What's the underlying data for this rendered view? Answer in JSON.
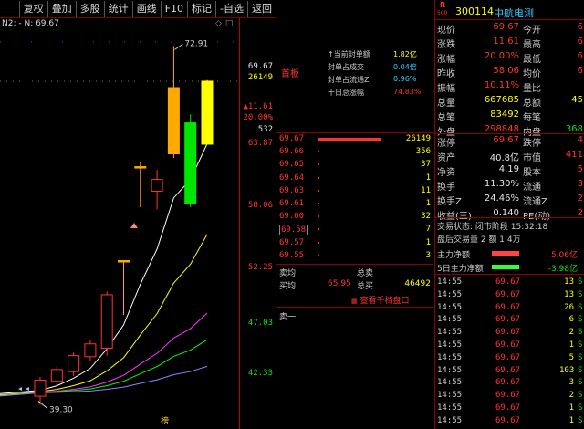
{
  "toolbar": {
    "items": [
      "复权",
      "叠加",
      "多股",
      "统计",
      "画线",
      "F10",
      "标记",
      "-自选",
      "返回"
    ]
  },
  "indicator": {
    "label": "N2: - N: 69.67",
    "icons": [
      "diamond-icon",
      "square-icon"
    ]
  },
  "chart": {
    "high_label": "72.91",
    "low_label": "39.30",
    "bottom_marker": "榜",
    "candles": [
      {
        "o": 40.1,
        "c": 41.6,
        "h": 41.9,
        "l": 39.3,
        "color": "red"
      },
      {
        "o": 41.5,
        "c": 42.6,
        "h": 42.9,
        "l": 41.1,
        "color": "red"
      },
      {
        "o": 42.4,
        "c": 43.9,
        "h": 44.2,
        "l": 42.0,
        "color": "red"
      },
      {
        "o": 43.8,
        "c": 45.0,
        "h": 45.4,
        "l": 43.4,
        "color": "red"
      },
      {
        "o": 44.6,
        "c": 49.6,
        "h": 49.9,
        "l": 43.9,
        "color": "red"
      },
      {
        "o": 52.8,
        "c": 52.8,
        "h": 52.8,
        "l": 47.7,
        "color": "orange"
      },
      {
        "o": 61.6,
        "c": 61.6,
        "h": 62.0,
        "l": 57.8,
        "color": "orange"
      },
      {
        "o": 59.3,
        "c": 60.4,
        "h": 61.3,
        "l": 57.6,
        "color": "red"
      },
      {
        "o": 62.8,
        "c": 69.0,
        "h": 72.9,
        "l": 62.4,
        "color": "orange"
      },
      {
        "o": 65.7,
        "c": 58.1,
        "h": 66.5,
        "l": 57.8,
        "color": "green"
      },
      {
        "o": 63.7,
        "c": 69.6,
        "h": 69.7,
        "l": 63.7,
        "color": "yellow"
      }
    ]
  },
  "price_axis": {
    "top_values": [
      "69.67",
      "26149",
      "▲11.61",
      "20.00%",
      "532"
    ],
    "ticks": [
      "63.87",
      "58.06",
      "52.25",
      "47.03",
      "42.33"
    ]
  },
  "seal": {
    "badge": "首板",
    "rows": [
      {
        "label": "↑当前封单额",
        "value": "1.82亿"
      },
      {
        "label": "封单占成交",
        "value": "0.04倍"
      },
      {
        "label": "封单占流通Z",
        "value": "0.96%"
      },
      {
        "label": "十日总涨幅",
        "value": "74.83%"
      }
    ]
  },
  "bids": [
    {
      "price": "69.67",
      "vol": "26149"
    },
    {
      "price": "69.66",
      "vol": "356"
    },
    {
      "price": "69.65",
      "vol": "37"
    },
    {
      "price": "69.64",
      "vol": "1"
    },
    {
      "price": "69.63",
      "vol": "11"
    },
    {
      "price": "69.61",
      "vol": "1"
    },
    {
      "price": "69.60",
      "vol": "32"
    },
    {
      "price": "69.58",
      "vol": "7"
    },
    {
      "price": "69.57",
      "vol": "1"
    },
    {
      "price": "69.55",
      "vol": "3"
    }
  ],
  "trade_summary": {
    "sell_label": "卖均",
    "total_sell_label": "总卖",
    "buy_label": "买均",
    "buy_avg": "65.95",
    "total_buy_label": "总买",
    "total_buy": "46492",
    "link": "查看千档盘口"
  },
  "ask_label": "卖一",
  "stock": {
    "badge_top": "R",
    "badge_bottom": "500",
    "code": "300114",
    "name": "中航电测"
  },
  "quote": [
    {
      "k1": "现价",
      "v1": "69.67",
      "k2": "今开",
      "v2": "6"
    },
    {
      "k1": "涨跌",
      "v1": "11.61",
      "k2": "最高",
      "v2": "6"
    },
    {
      "k1": "涨幅",
      "v1": "20.00%",
      "k2": "最低",
      "v2": "6"
    },
    {
      "k1": "昨收",
      "v1": "58.06",
      "k2": "均价",
      "v2": "6"
    },
    {
      "k1": "振幅",
      "v1": "10.11%",
      "k2": "量比",
      "v2": ""
    },
    {
      "k1": "总量",
      "v1": "667685",
      "k2": "总额",
      "v2": "45"
    },
    {
      "k1": "总笔",
      "v1": "83492",
      "k2": "每笔",
      "v2": ""
    },
    {
      "k1": "外盘",
      "v1": "298848",
      "k2": "内盘",
      "v2": "368"
    }
  ],
  "fundamentals": [
    {
      "k1": "涨停",
      "v1": "69.67",
      "k2": "跌停",
      "v2": "4"
    },
    {
      "k1": "资产",
      "v1": "40.8亿",
      "k2": "市值",
      "v2": "411"
    },
    {
      "k1": "净资",
      "v1": "4.19",
      "k2": "股本",
      "v2": "5"
    },
    {
      "k1": "换手",
      "v1": "11.30%",
      "k2": "流通",
      "v2": "3"
    },
    {
      "k1": "换手Z",
      "v1": "24.46%",
      "k2": "流通Z",
      "v2": "2"
    },
    {
      "k1": "收益(三)",
      "v1": "0.140",
      "k2": "PE(动)",
      "v2": "2"
    }
  ],
  "status": {
    "trade_state": "交易状态: 闭市阶段 15:32:18",
    "after_hours": "盘后交易量 2 额 1.4万"
  },
  "flows": [
    {
      "label": "主力净额",
      "value": "5.06亿",
      "color": "#ff4444"
    },
    {
      "label": "5日主力净额",
      "value": "-3.98亿",
      "color": "#33ff33"
    }
  ],
  "ticks": [
    {
      "time": "14:55",
      "price": "69.67",
      "vol": "13",
      "side": "S"
    },
    {
      "time": "14:55",
      "price": "69.67",
      "vol": "13",
      "side": "S"
    },
    {
      "time": "14:55",
      "price": "69.67",
      "vol": "26",
      "side": "S"
    },
    {
      "time": "14:55",
      "price": "69.67",
      "vol": "6",
      "side": "S"
    },
    {
      "time": "14:55",
      "price": "69.67",
      "vol": "2",
      "side": "S"
    },
    {
      "time": "14:55",
      "price": "69.67",
      "vol": "1",
      "side": "S"
    },
    {
      "time": "14:55",
      "price": "69.67",
      "vol": "5",
      "side": "S"
    },
    {
      "time": "14:55",
      "price": "69.67",
      "vol": "103",
      "side": "S"
    },
    {
      "time": "14:55",
      "price": "69.67",
      "vol": "3",
      "side": "S"
    },
    {
      "time": "14:55",
      "price": "69.67",
      "vol": "2",
      "side": "S"
    },
    {
      "time": "14:55",
      "price": "69.67",
      "vol": "1",
      "side": "S"
    },
    {
      "time": "14:55",
      "price": "69.67",
      "vol": "1",
      "side": "S"
    }
  ],
  "colors": {
    "up": "#ff3232",
    "down": "#00e600",
    "orange": "#ffaa00",
    "yellow": "#ffff00",
    "ma5": "#ffffff",
    "ma10": "#ffff00",
    "ma20": "#ff33ff",
    "ma30": "#00ff00",
    "ma60": "#8888ff"
  }
}
